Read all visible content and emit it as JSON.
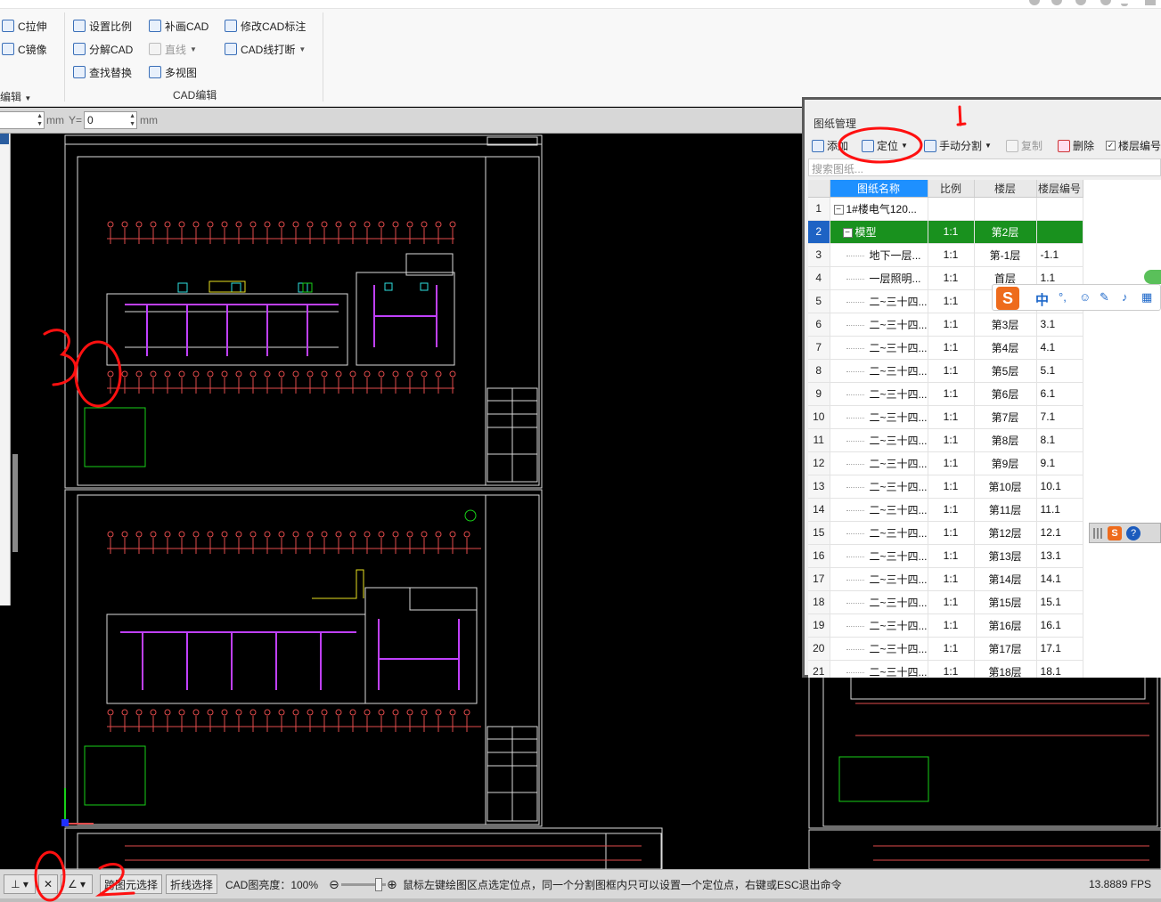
{
  "ribbon": {
    "col1": [
      {
        "label": "C拉伸",
        "icon": "stretch-icon"
      },
      {
        "label": "C镜像",
        "icon": "mirror-icon"
      }
    ],
    "group1_label": "编辑",
    "col2": [
      {
        "label": "设置比例",
        "icon": "scale-icon"
      },
      {
        "label": "分解CAD",
        "icon": "explode-icon"
      },
      {
        "label": "查找替换",
        "icon": "find-replace-icon"
      }
    ],
    "col3": [
      {
        "label": "补画CAD",
        "icon": "draw-icon"
      },
      {
        "label": "直线",
        "icon": "line-icon"
      },
      {
        "label": "多视图",
        "icon": "multiview-icon"
      }
    ],
    "col4": [
      {
        "label": "修改CAD标注",
        "icon": "edit-annotation-icon"
      },
      {
        "label": "CAD线打断",
        "icon": "break-line-icon"
      }
    ],
    "group2_label": "CAD编辑"
  },
  "coordbar": {
    "x_value": "",
    "unit1": "mm",
    "y_label": "Y=",
    "y_value": "0",
    "unit2": "mm"
  },
  "panel": {
    "title": "图纸管理",
    "toolbar": {
      "add": "添加",
      "locate": "定位",
      "manual_split": "手动分割",
      "copy": "复制",
      "delete": "删除",
      "floor_no": "楼层编号"
    },
    "search_placeholder": "搜索图纸...",
    "columns": [
      "图纸名称",
      "比例",
      "楼层",
      "楼层编号"
    ],
    "rows": [
      {
        "no": "1",
        "name": "1#楼电气120...",
        "scale": "",
        "floor": "",
        "floor_no": "",
        "toggle": "−",
        "level": 0
      },
      {
        "no": "2",
        "name": "模型",
        "scale": "1:1",
        "floor": "第2层",
        "floor_no": "",
        "toggle": "−",
        "level": 1,
        "selected": true
      },
      {
        "no": "3",
        "name": "地下一层...",
        "scale": "1:1",
        "floor": "第-1层",
        "floor_no": "-1.1",
        "level": 2
      },
      {
        "no": "4",
        "name": "一层照明...",
        "scale": "1:1",
        "floor": "首层",
        "floor_no": "1.1",
        "level": 2
      },
      {
        "no": "5",
        "name": "二~三十四...",
        "scale": "1:1",
        "floor": "",
        "floor_no": "",
        "level": 2
      },
      {
        "no": "6",
        "name": "二~三十四...",
        "scale": "1:1",
        "floor": "第3层",
        "floor_no": "3.1",
        "level": 2
      },
      {
        "no": "7",
        "name": "二~三十四...",
        "scale": "1:1",
        "floor": "第4层",
        "floor_no": "4.1",
        "level": 2
      },
      {
        "no": "8",
        "name": "二~三十四...",
        "scale": "1:1",
        "floor": "第5层",
        "floor_no": "5.1",
        "level": 2
      },
      {
        "no": "9",
        "name": "二~三十四...",
        "scale": "1:1",
        "floor": "第6层",
        "floor_no": "6.1",
        "level": 2
      },
      {
        "no": "10",
        "name": "二~三十四...",
        "scale": "1:1",
        "floor": "第7层",
        "floor_no": "7.1",
        "level": 2
      },
      {
        "no": "11",
        "name": "二~三十四...",
        "scale": "1:1",
        "floor": "第8层",
        "floor_no": "8.1",
        "level": 2
      },
      {
        "no": "12",
        "name": "二~三十四...",
        "scale": "1:1",
        "floor": "第9层",
        "floor_no": "9.1",
        "level": 2
      },
      {
        "no": "13",
        "name": "二~三十四...",
        "scale": "1:1",
        "floor": "第10层",
        "floor_no": "10.1",
        "level": 2
      },
      {
        "no": "14",
        "name": "二~三十四...",
        "scale": "1:1",
        "floor": "第11层",
        "floor_no": "11.1",
        "level": 2
      },
      {
        "no": "15",
        "name": "二~三十四...",
        "scale": "1:1",
        "floor": "第12层",
        "floor_no": "12.1",
        "level": 2
      },
      {
        "no": "16",
        "name": "二~三十四...",
        "scale": "1:1",
        "floor": "第13层",
        "floor_no": "13.1",
        "level": 2
      },
      {
        "no": "17",
        "name": "二~三十四...",
        "scale": "1:1",
        "floor": "第14层",
        "floor_no": "14.1",
        "level": 2
      },
      {
        "no": "18",
        "name": "二~三十四...",
        "scale": "1:1",
        "floor": "第15层",
        "floor_no": "15.1",
        "level": 2
      },
      {
        "no": "19",
        "name": "二~三十四...",
        "scale": "1:1",
        "floor": "第16层",
        "floor_no": "16.1",
        "level": 2
      },
      {
        "no": "20",
        "name": "二~三十四...",
        "scale": "1:1",
        "floor": "第17层",
        "floor_no": "17.1",
        "level": 2
      },
      {
        "no": "21",
        "name": "二~三十四...",
        "scale": "1:1",
        "floor": "第18层",
        "floor_no": "18.1",
        "level": 2
      }
    ]
  },
  "ime": {
    "zh": "中",
    "punct": "°,"
  },
  "statusbar": {
    "cross_select": "跨图元选择",
    "poly_select": "折线选择",
    "brightness_label": "CAD图亮度：100%",
    "brightness_value": 100,
    "hint": "鼠标左键绘图区点选定位点，同一个分割图框内只可以设置一个定位点，右键或ESC退出命令",
    "fps": "13.8889 FPS"
  },
  "colors": {
    "selected_row": "#19911e",
    "header_blue": "#1e90ff",
    "annotation_red": "#ff1010",
    "cad_red": "#e24b4b",
    "cad_magenta": "#c040ff",
    "cad_cyan": "#2ee0e0",
    "cad_green": "#18d018"
  }
}
